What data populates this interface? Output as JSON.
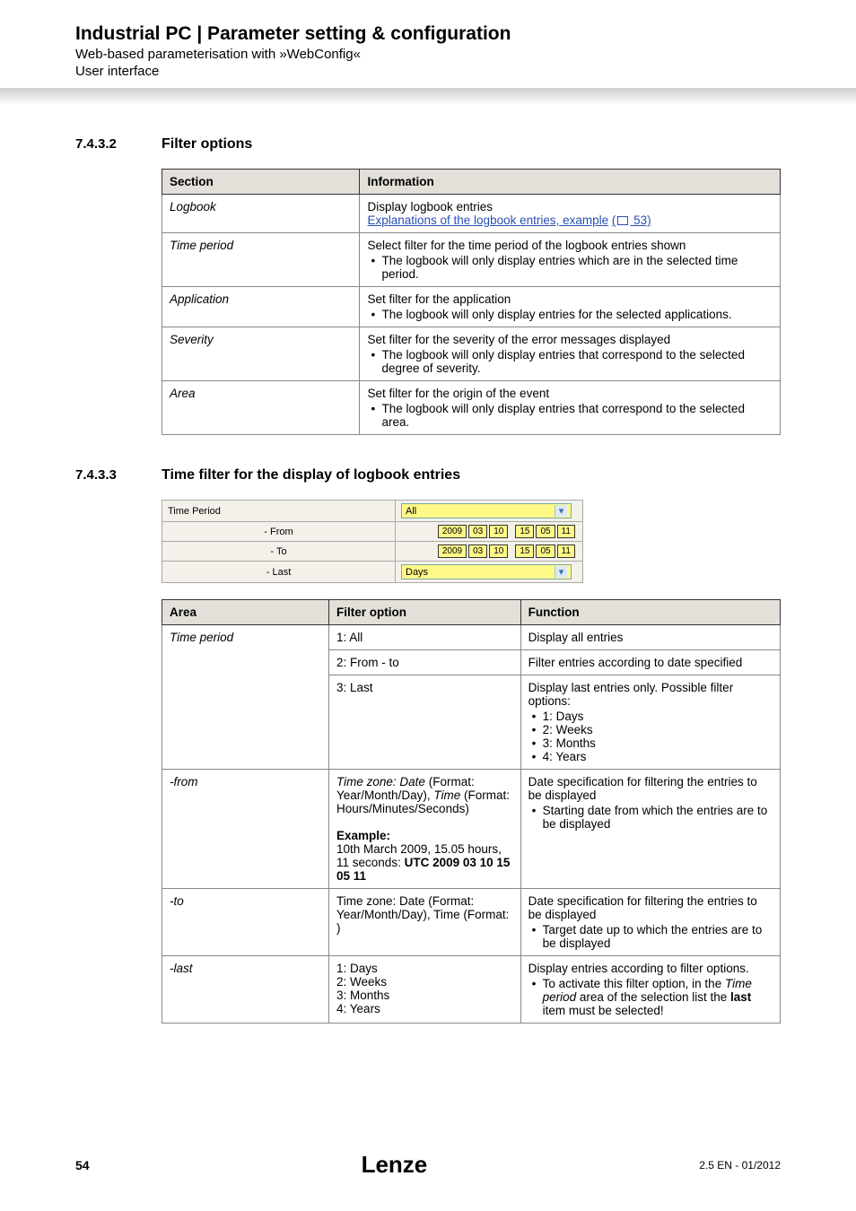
{
  "header": {
    "title": "Industrial PC | Parameter setting & configuration",
    "sub1": "Web-based parameterisation with »WebConfig«",
    "sub2": "User interface"
  },
  "sections": {
    "s1": {
      "num": "7.4.3.2",
      "title": "Filter options"
    },
    "s2": {
      "num": "7.4.3.3",
      "title": "Time filter for the display of logbook entries"
    }
  },
  "table1": {
    "h1": "Section",
    "h2": "Information",
    "rows": [
      {
        "c1": "Logbook",
        "c2a": "Display logbook entries",
        "c2b": "Explanations of the logbook entries, example",
        "c2c": " 53)"
      },
      {
        "c1": "Time period",
        "c2a": "Select filter for the time period of the logbook entries shown",
        "c2b": "The logbook will only display entries which are in the selected time period."
      },
      {
        "c1": "Application",
        "c2a": "Set filter for the application",
        "c2b": "The logbook will only display entries for the selected applications."
      },
      {
        "c1": "Severity",
        "c2a": "Set filter for the severity of the error messages displayed",
        "c2b": "The logbook will only display entries that correspond to the selected degree of severity."
      },
      {
        "c1": "Area",
        "c2a": "Set filter for the origin of the event",
        "c2b": "The logbook will only display entries that correspond to the selected area."
      }
    ]
  },
  "shot": {
    "r1": "Time Period",
    "r1v": "All",
    "r2": "- From",
    "r3": "- To",
    "r4": "- Last",
    "r4v": "Days",
    "date": [
      "2009",
      "03",
      "10",
      "15",
      "05",
      "11"
    ]
  },
  "table2": {
    "h1": "Area",
    "h2": "Filter option",
    "h3": "Function",
    "grp1_c1": "Time period",
    "grp1_r1_c2": "1: All",
    "grp1_r1_c3": "Display all entries",
    "grp1_r2_c2": "2: From - to",
    "grp1_r2_c3": "Filter entries according to date specified",
    "grp1_r3_c2": "3: Last",
    "grp1_r3_c3a": "Display last entries only. Possible filter options:",
    "grp1_r3_c3b1": "1: Days",
    "grp1_r3_c3b2": "2: Weeks",
    "grp1_r3_c3b3": "3: Months",
    "grp1_r3_c3b4": "4: Years",
    "r_from_c1": "-from",
    "r_from_c2_a": "Time zone: Date",
    "r_from_c2_b": " (Format: Year/Month/Day), ",
    "r_from_c2_c": "Time",
    "r_from_c2_d": " (Format: Hours/Minutes/Seconds)",
    "r_from_c2_ex_lbl": "Example:",
    "r_from_c2_ex1": "10th March 2009, 15.05 hours, 11 seconds: ",
    "r_from_c2_ex2": "UTC    2009 03 10 15 05 11",
    "r_from_c3a": "Date specification for filtering the entries to be displayed",
    "r_from_c3b": "Starting date from which the entries are to be displayed",
    "r_to_c1": "-to",
    "r_to_c2": "Time zone: Date (Format: Year/Month/Day), Time (Format: )",
    "r_to_c3a": "Date specification for filtering the entries to be displayed",
    "r_to_c3b": "Target date up to which the entries are to be displayed",
    "r_last_c1": "-last",
    "r_last_c2_1": "1: Days",
    "r_last_c2_2": "2: Weeks",
    "r_last_c2_3": "3: Months",
    "r_last_c2_4": "4: Years",
    "r_last_c3a": "Display entries according to filter options.",
    "r_last_c3b_pre": "To activate this filter option, in the ",
    "r_last_c3b_it": "Time period",
    "r_last_c3b_mid": " area of the selection list the ",
    "r_last_c3b_bold": "last",
    "r_last_c3b_post": " item must be selected!"
  },
  "footer": {
    "page": "54",
    "logo": "Lenze",
    "ver": "2.5 EN - 01/2012"
  }
}
